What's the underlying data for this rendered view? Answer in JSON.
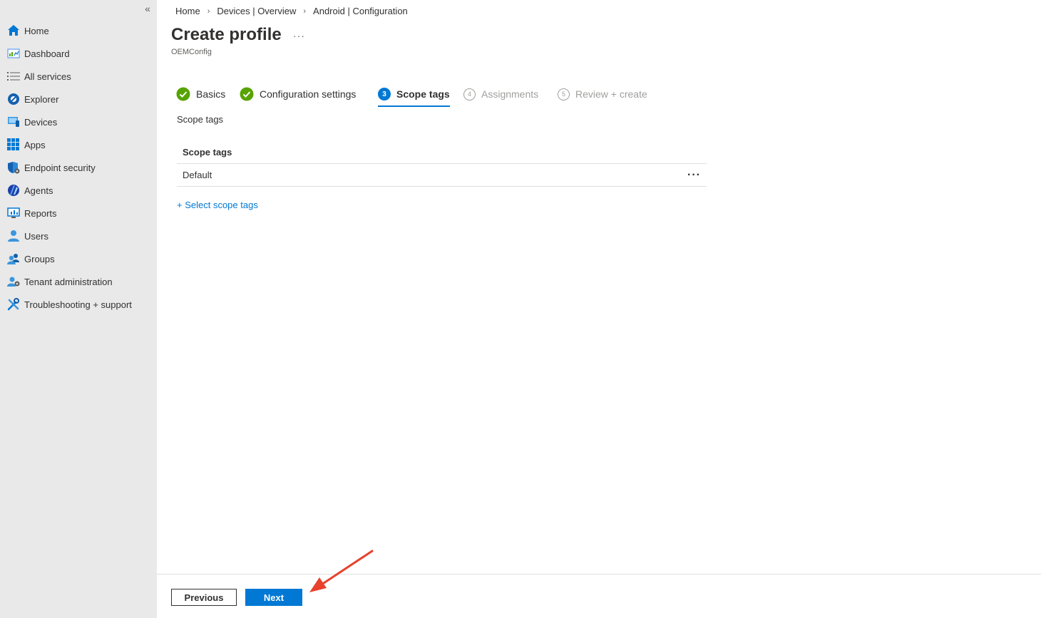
{
  "sidebar": {
    "collapse_icon": "double-chevron-left-icon",
    "items": [
      {
        "label": "Home",
        "icon": "home-icon"
      },
      {
        "label": "Dashboard",
        "icon": "dashboard-icon"
      },
      {
        "label": "All services",
        "icon": "list-icon"
      },
      {
        "label": "Explorer",
        "icon": "explorer-icon"
      },
      {
        "label": "Devices",
        "icon": "devices-icon"
      },
      {
        "label": "Apps",
        "icon": "apps-grid-icon"
      },
      {
        "label": "Endpoint security",
        "icon": "shield-icon"
      },
      {
        "label": "Agents",
        "icon": "agents-icon"
      },
      {
        "label": "Reports",
        "icon": "reports-icon"
      },
      {
        "label": "Users",
        "icon": "user-icon"
      },
      {
        "label": "Groups",
        "icon": "groups-icon"
      },
      {
        "label": "Tenant administration",
        "icon": "tenant-admin-icon"
      },
      {
        "label": "Troubleshooting + support",
        "icon": "tools-icon"
      }
    ]
  },
  "breadcrumb": [
    "Home",
    "Devices | Overview",
    "Android | Configuration"
  ],
  "header": {
    "title": "Create profile",
    "more": "···",
    "subtitle": "OEMConfig"
  },
  "steps": [
    {
      "label": "Basics",
      "state": "done"
    },
    {
      "label": "Configuration settings",
      "state": "done"
    },
    {
      "label": "Scope tags",
      "state": "active",
      "number": "3"
    },
    {
      "label": "Assignments",
      "state": "disabled",
      "number": "4"
    },
    {
      "label": "Review + create",
      "state": "disabled",
      "number": "5"
    }
  ],
  "scope": {
    "section_label": "Scope tags",
    "table_header": "Scope tags",
    "rows": [
      {
        "name": "Default",
        "more": "···"
      }
    ],
    "select_link": "+ Select scope tags"
  },
  "footer": {
    "previous_label": "Previous",
    "next_label": "Next"
  },
  "colors": {
    "accent": "#0078d4",
    "success": "#57a300",
    "sidebar_bg": "#e9e9e9",
    "annotation_arrow": "#e8412c"
  }
}
